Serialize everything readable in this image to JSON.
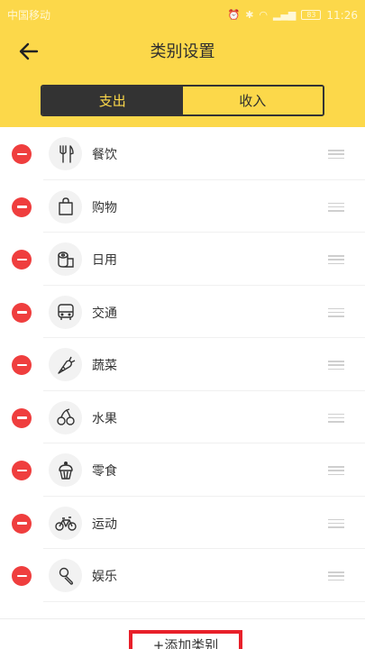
{
  "status_bar": {
    "carrier": "中国移动",
    "time": "11:26",
    "battery": "83"
  },
  "header": {
    "title": "类别设置"
  },
  "tabs": [
    {
      "label": "支出",
      "active": true
    },
    {
      "label": "收入",
      "active": false
    }
  ],
  "categories": [
    {
      "label": "餐饮",
      "icon": "utensils-icon"
    },
    {
      "label": "购物",
      "icon": "shopping-bag-icon"
    },
    {
      "label": "日用",
      "icon": "tissue-roll-icon"
    },
    {
      "label": "交通",
      "icon": "bus-icon"
    },
    {
      "label": "蔬菜",
      "icon": "carrot-icon"
    },
    {
      "label": "水果",
      "icon": "cherries-icon"
    },
    {
      "label": "零食",
      "icon": "cupcake-icon"
    },
    {
      "label": "运动",
      "icon": "bicycle-icon"
    },
    {
      "label": "娱乐",
      "icon": "microphone-icon"
    }
  ],
  "footer": {
    "add_label": "+添加类别"
  },
  "colors": {
    "accent": "#fcd84a",
    "dark": "#333333",
    "delete": "#ef3e3e",
    "highlight": "#e8202a"
  }
}
